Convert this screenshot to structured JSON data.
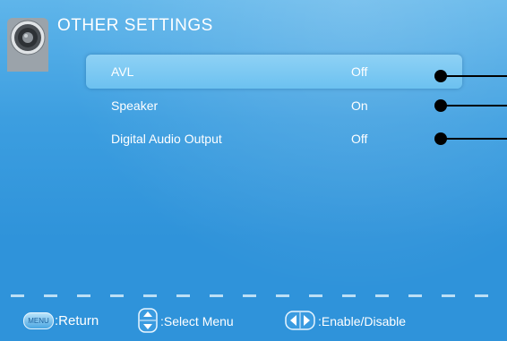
{
  "header": {
    "title": "OTHER SETTINGS",
    "icon": "speaker-icon"
  },
  "menu": {
    "items": [
      {
        "label": "AVL",
        "value": "Off",
        "selected": true
      },
      {
        "label": "Speaker",
        "value": "On",
        "selected": false
      },
      {
        "label": "Digital Audio Output",
        "value": "Off",
        "selected": false
      }
    ]
  },
  "footer": {
    "menu_key_text": "MENU",
    "menu_key_action": ":Return",
    "updown_action": ":Select Menu",
    "leftright_action": ":Enable/Disable"
  },
  "colors": {
    "background": "#3c9ee0",
    "highlight": "#7cc9f2",
    "text": "#ffffff"
  }
}
